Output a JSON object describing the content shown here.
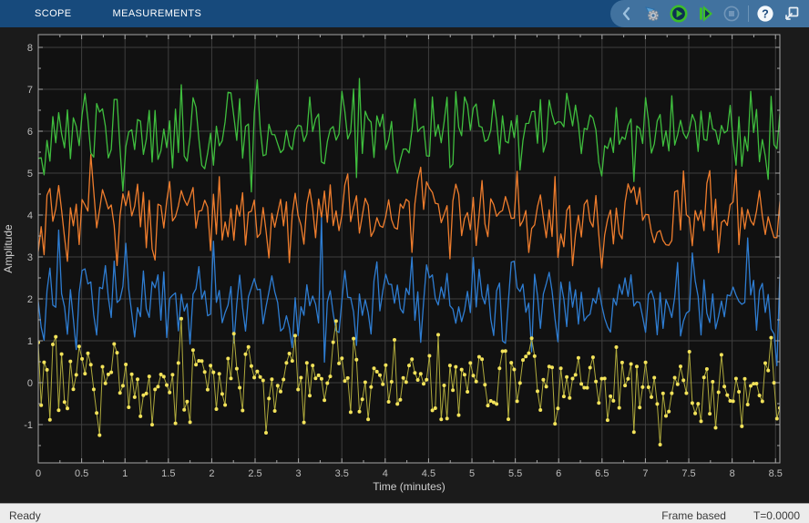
{
  "app": {
    "title": "Scope"
  },
  "toolbar": {
    "tabs": [
      {
        "id": "scope",
        "label": "SCOPE"
      },
      {
        "id": "measurements",
        "label": "MEASUREMENTS"
      }
    ],
    "actions": [
      {
        "id": "collapse-toolstrip",
        "icon": "chevron-left-icon"
      },
      {
        "id": "simulation-settings",
        "icon": "gear-flag-icon"
      },
      {
        "id": "run",
        "icon": "play-icon",
        "enabled": true
      },
      {
        "id": "step-forward",
        "icon": "step-forward-icon",
        "enabled": true
      },
      {
        "id": "stop",
        "icon": "stop-icon",
        "enabled": false
      },
      {
        "id": "help",
        "icon": "question-icon"
      },
      {
        "id": "dock",
        "icon": "popout-icon"
      }
    ],
    "colors": {
      "bar": "#174A7C",
      "pill": "#41729F",
      "chevron": "#9DC1DE"
    }
  },
  "chart_data": {
    "type": "line",
    "title": "",
    "xlabel": "Time (minutes)",
    "ylabel": "Amplitude",
    "xlim": [
      0,
      8.55
    ],
    "ylim": [
      -1.91,
      8.3
    ],
    "x_ticks": [
      0,
      0.5,
      1,
      1.5,
      2,
      2.5,
      3,
      3.5,
      4,
      4.5,
      5,
      5.5,
      6,
      6.5,
      7,
      7.5,
      8,
      8.5
    ],
    "x_tick_labels": [
      "0",
      "0.5",
      "1",
      "1.5",
      "2",
      "2.5",
      "3",
      "3.5",
      "4",
      "4.5",
      "5",
      "5.5",
      "6",
      "6.5",
      "7",
      "7.5",
      "8",
      "8.5"
    ],
    "y_ticks": [
      -1,
      0,
      1,
      2,
      3,
      4,
      5,
      6,
      7,
      8
    ],
    "y_tick_labels": [
      "-1",
      "0",
      "1",
      "2",
      "3",
      "4",
      "5",
      "6",
      "7",
      "8"
    ],
    "grid": true,
    "legend": "none",
    "background": "#111111",
    "grid_color": "#3E3E3E",
    "axis_border_color": "#A6A6A6",
    "tick_label_color": "#BDBDBD",
    "axis_label_color": "#CFCFCF",
    "signal_type": "random-noise",
    "n_points": 255,
    "seed": 11,
    "series": [
      {
        "name": "channel-1-green",
        "color": "#3FBE3E",
        "mean": 6,
        "std": 0.55,
        "markers": false
      },
      {
        "name": "channel-2-orange",
        "color": "#EF7D2D",
        "mean": 4,
        "std": 0.52,
        "markers": false
      },
      {
        "name": "channel-3-blue",
        "color": "#2E7DD2",
        "mean": 2,
        "std": 0.55,
        "markers": false
      },
      {
        "name": "channel-4-yellow",
        "color": "#AFAA3C",
        "marker_color": "#F3E35A",
        "mean": 0,
        "std": 0.55,
        "markers": true
      }
    ]
  },
  "statusbar": {
    "ready": "Ready",
    "frame_mode": "Frame based",
    "sim_time": "T=0.0000"
  }
}
